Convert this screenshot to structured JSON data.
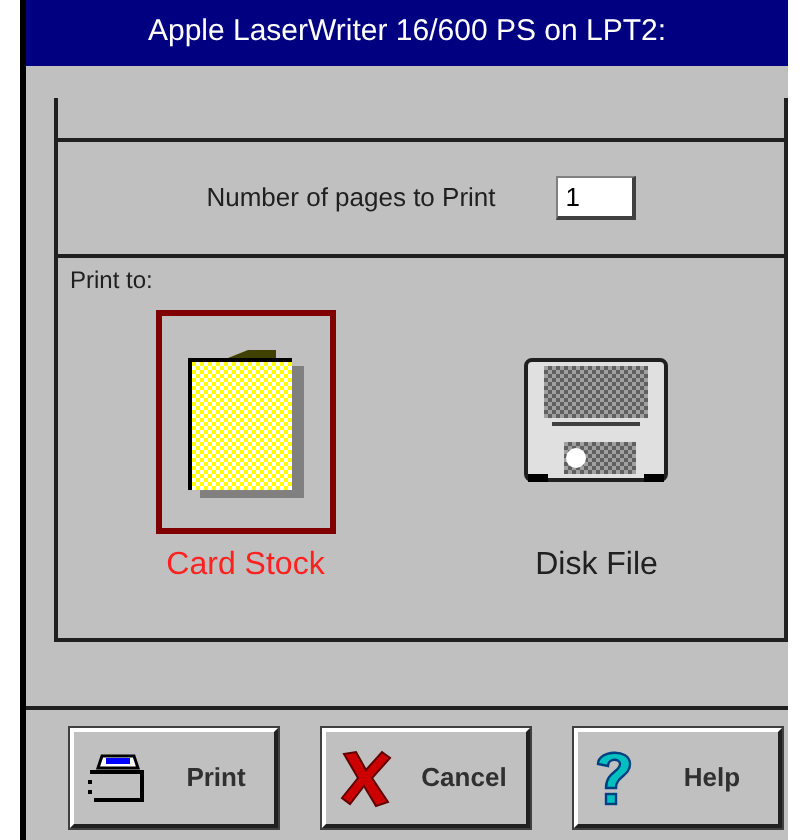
{
  "window": {
    "title": "Apple LaserWriter 16/600 PS on LPT2:"
  },
  "pages_field": {
    "label": "Number of pages to Print",
    "value": "1"
  },
  "print_to": {
    "label": "Print to:",
    "options": [
      {
        "label": "Card Stock",
        "kind": "card",
        "selected": true
      },
      {
        "label": "Disk File",
        "kind": "disk",
        "selected": false
      }
    ]
  },
  "buttons": [
    {
      "label": "Print",
      "kind": "print"
    },
    {
      "label": "Cancel",
      "kind": "cancel"
    },
    {
      "label": "Help",
      "kind": "help"
    }
  ]
}
